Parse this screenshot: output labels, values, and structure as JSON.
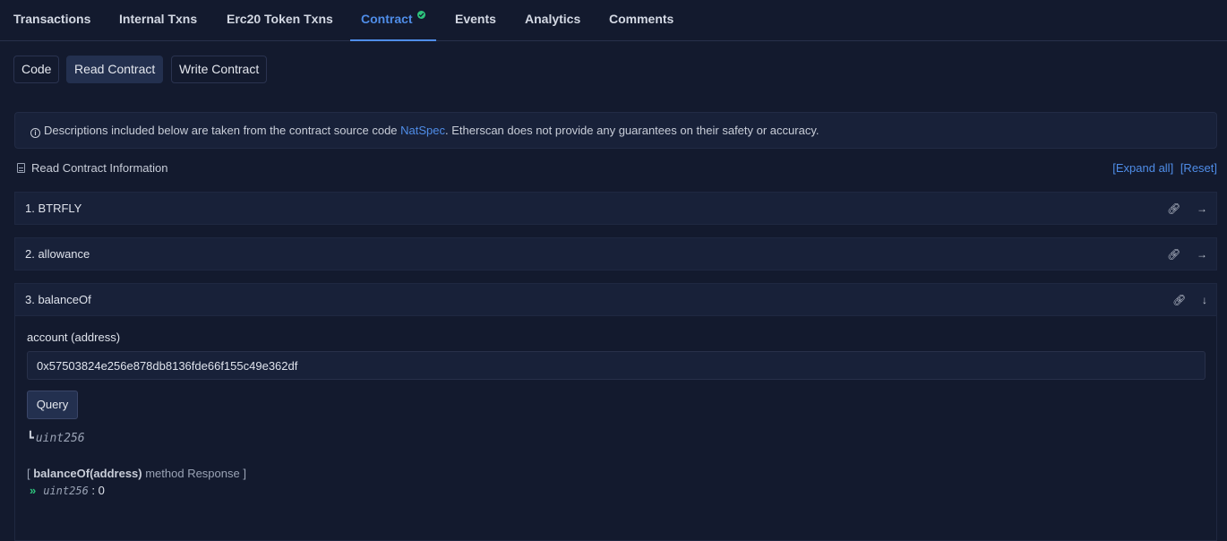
{
  "tabs": [
    {
      "label": "Transactions"
    },
    {
      "label": "Internal Txns"
    },
    {
      "label": "Erc20 Token Txns"
    },
    {
      "label": "Contract"
    },
    {
      "label": "Events"
    },
    {
      "label": "Analytics"
    },
    {
      "label": "Comments"
    }
  ],
  "subtabs": [
    {
      "label": "Code"
    },
    {
      "label": "Read Contract"
    },
    {
      "label": "Write Contract"
    }
  ],
  "notice": {
    "prefix": "Descriptions included below are taken from the contract source code ",
    "link": "NatSpec",
    "suffix": ". Etherscan does not provide any guarantees on their safety or accuracy."
  },
  "section": {
    "title": "Read Contract Information",
    "expand_all": "[Expand all]",
    "reset": "[Reset]"
  },
  "functions": [
    {
      "label": "1. BTRFLY"
    },
    {
      "label": "2. allowance"
    },
    {
      "label": "3. balanceOf"
    }
  ],
  "balanceOf": {
    "input_label": "account (address)",
    "input_value": "0x57503824e256e878db8136fde66f155c49e362df",
    "query_label": "Query",
    "return_type": "uint256",
    "response_open": "[ ",
    "response_method": "balanceOf(address)",
    "response_rest": " method Response ]",
    "response_type": "uint256",
    "response_sep": " : ",
    "response_value": "0"
  },
  "colors": {
    "accent": "#4f8de8",
    "success": "#2ec47c",
    "background": "#131a2e"
  }
}
